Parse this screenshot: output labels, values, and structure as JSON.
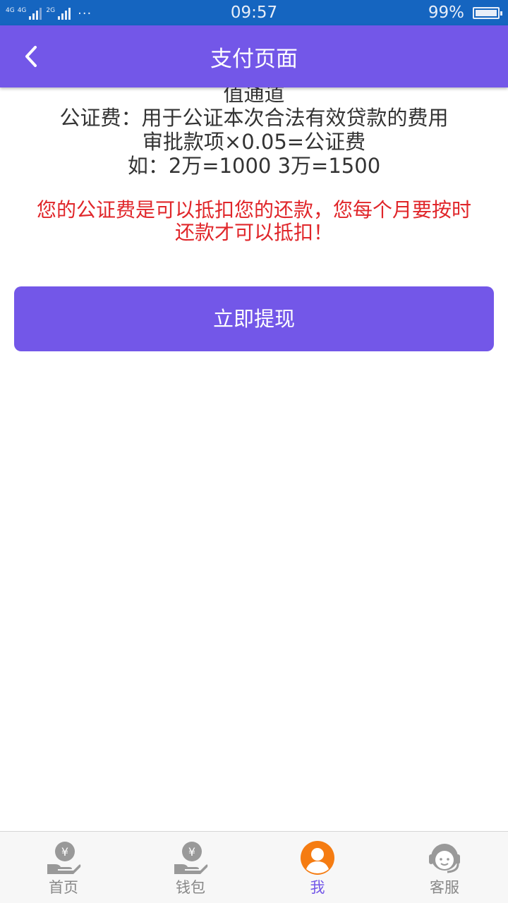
{
  "status_bar": {
    "network_1": "4G",
    "network_2": "4G",
    "network_3": "2G",
    "dots": "···",
    "time": "09:57",
    "battery": "99%"
  },
  "header": {
    "title": "支付页面",
    "back_icon": "chevron-left-icon"
  },
  "content": {
    "clipped_line": "值通道",
    "lines": [
      "公证费：用于公证本次合法有效贷款的费用",
      "审批款项×0.05=公证费",
      "如：2万=1000  3万=1500"
    ],
    "warning_lines": [
      "您的公证费是可以抵扣您的还款，您每个月要按时",
      "还款才可以抵扣！"
    ],
    "warning_color": "#e0262a"
  },
  "submit_button": {
    "label": "立即提现"
  },
  "bottom_nav": {
    "items": [
      {
        "label": "首页",
        "icon": "hand-yen-icon",
        "active": false
      },
      {
        "label": "钱包",
        "icon": "hand-yen-icon",
        "active": false
      },
      {
        "label": "我",
        "icon": "user-avatar-icon",
        "active": true
      },
      {
        "label": "客服",
        "icon": "headset-icon",
        "active": false
      }
    ]
  },
  "colors": {
    "status_bar": "#1565c0",
    "accent": "#7357e8",
    "active_icon": "#f57c12",
    "inactive_icon": "#999999"
  }
}
